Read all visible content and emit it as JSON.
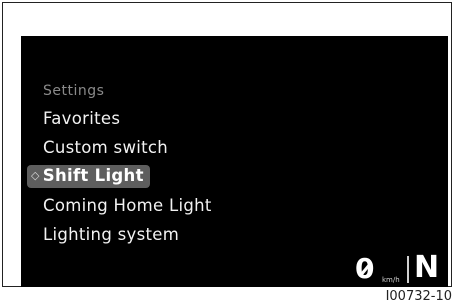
{
  "menu": {
    "title": "Settings",
    "items": [
      {
        "label": "Favorites",
        "selected": false
      },
      {
        "label": "Custom switch",
        "selected": false
      },
      {
        "label": "Shift Light",
        "selected": true
      },
      {
        "label": "Coming  Home Light",
        "selected": false
      },
      {
        "label": "Lighting system",
        "selected": false
      }
    ],
    "selection_indicator_icon": "diamond-icon"
  },
  "status": {
    "speed": "0",
    "speed_unit": "km/h",
    "gear": "N"
  },
  "figure_code": "I00732-10",
  "colors": {
    "screen_background": "#000000",
    "selection_highlight": "#5e5e5e",
    "menu_title": "#8a8a8a",
    "menu_text": "#f2f2f2"
  }
}
